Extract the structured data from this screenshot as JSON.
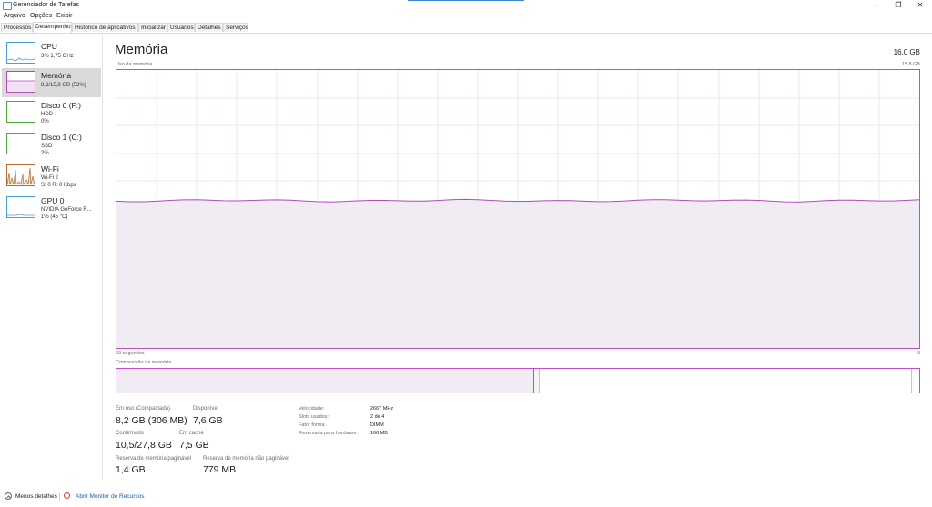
{
  "window": {
    "title": "Gerenciador de Tarefas",
    "controls": {
      "minimize": "–",
      "maximize": "❐",
      "close": "✕"
    }
  },
  "menu": [
    "Arquivo",
    "Opções",
    "Exibir"
  ],
  "tabs": [
    "Processos",
    "Desempenho",
    "Histórico de aplicativos",
    "Inicializar",
    "Usuários",
    "Detalhes",
    "Serviços"
  ],
  "active_tab": "Desempenho",
  "sidebar": {
    "items": [
      {
        "title": "CPU",
        "lines": [
          "3% 1,75 GHz"
        ],
        "color": "#4a9fd8"
      },
      {
        "title": "Memória",
        "lines": [
          "8,3/15,8 GB (53%)"
        ],
        "color": "#b04cb8",
        "selected": true
      },
      {
        "title": "Disco 0 (F:)",
        "lines": [
          "HDD",
          "0%"
        ],
        "color": "#4eaa3c"
      },
      {
        "title": "Disco 1 (C:)",
        "lines": [
          "SSD",
          "2%"
        ],
        "color": "#4eaa3c"
      },
      {
        "title": "Wi-Fi",
        "lines": [
          "Wi-Fi 2",
          "S: 0 R: 0 Kbps"
        ],
        "color": "#b46a2c"
      },
      {
        "title": "GPU 0",
        "lines": [
          "NVIDIA GeForce R...",
          "1% (45 °C)"
        ],
        "color": "#4a9fd8"
      }
    ]
  },
  "main": {
    "title": "Memória",
    "total": "16,0 GB",
    "usage_label": "Uso da memória",
    "usage_max": "15,8 GB",
    "time_label": "60 segundos",
    "time_end": "0",
    "composition_label": "Composição da memória",
    "usage_fraction": 0.53,
    "accent_color": "#c04fc4"
  },
  "stats": {
    "in_use_label": "Em uso (Compactada)",
    "in_use_value": "8,2 GB (306 MB)",
    "available_label": "Disponível",
    "available_value": "7,6 GB",
    "committed_label": "Confirmado",
    "committed_value": "10,5/27,8 GB",
    "cached_label": "Em cache",
    "cached_value": "7,5 GB",
    "paged_label": "Reserva de memória paginável",
    "paged_value": "1,4 GB",
    "nonpaged_label": "Reserva de memória não paginável",
    "nonpaged_value": "779 MB"
  },
  "hardware": {
    "speed_label": "Velocidade:",
    "speed_value": "2667 MHz",
    "slots_label": "Slots usados:",
    "slots_value": "2 de 4",
    "form_label": "Fator forma:",
    "form_value": "DIMM",
    "reserved_label": "Reservada para hardware:",
    "reserved_value": "166 MB"
  },
  "footer": {
    "less_details": "Menos detalhes",
    "resource_monitor": "Abrir Monitor de Recursos"
  }
}
